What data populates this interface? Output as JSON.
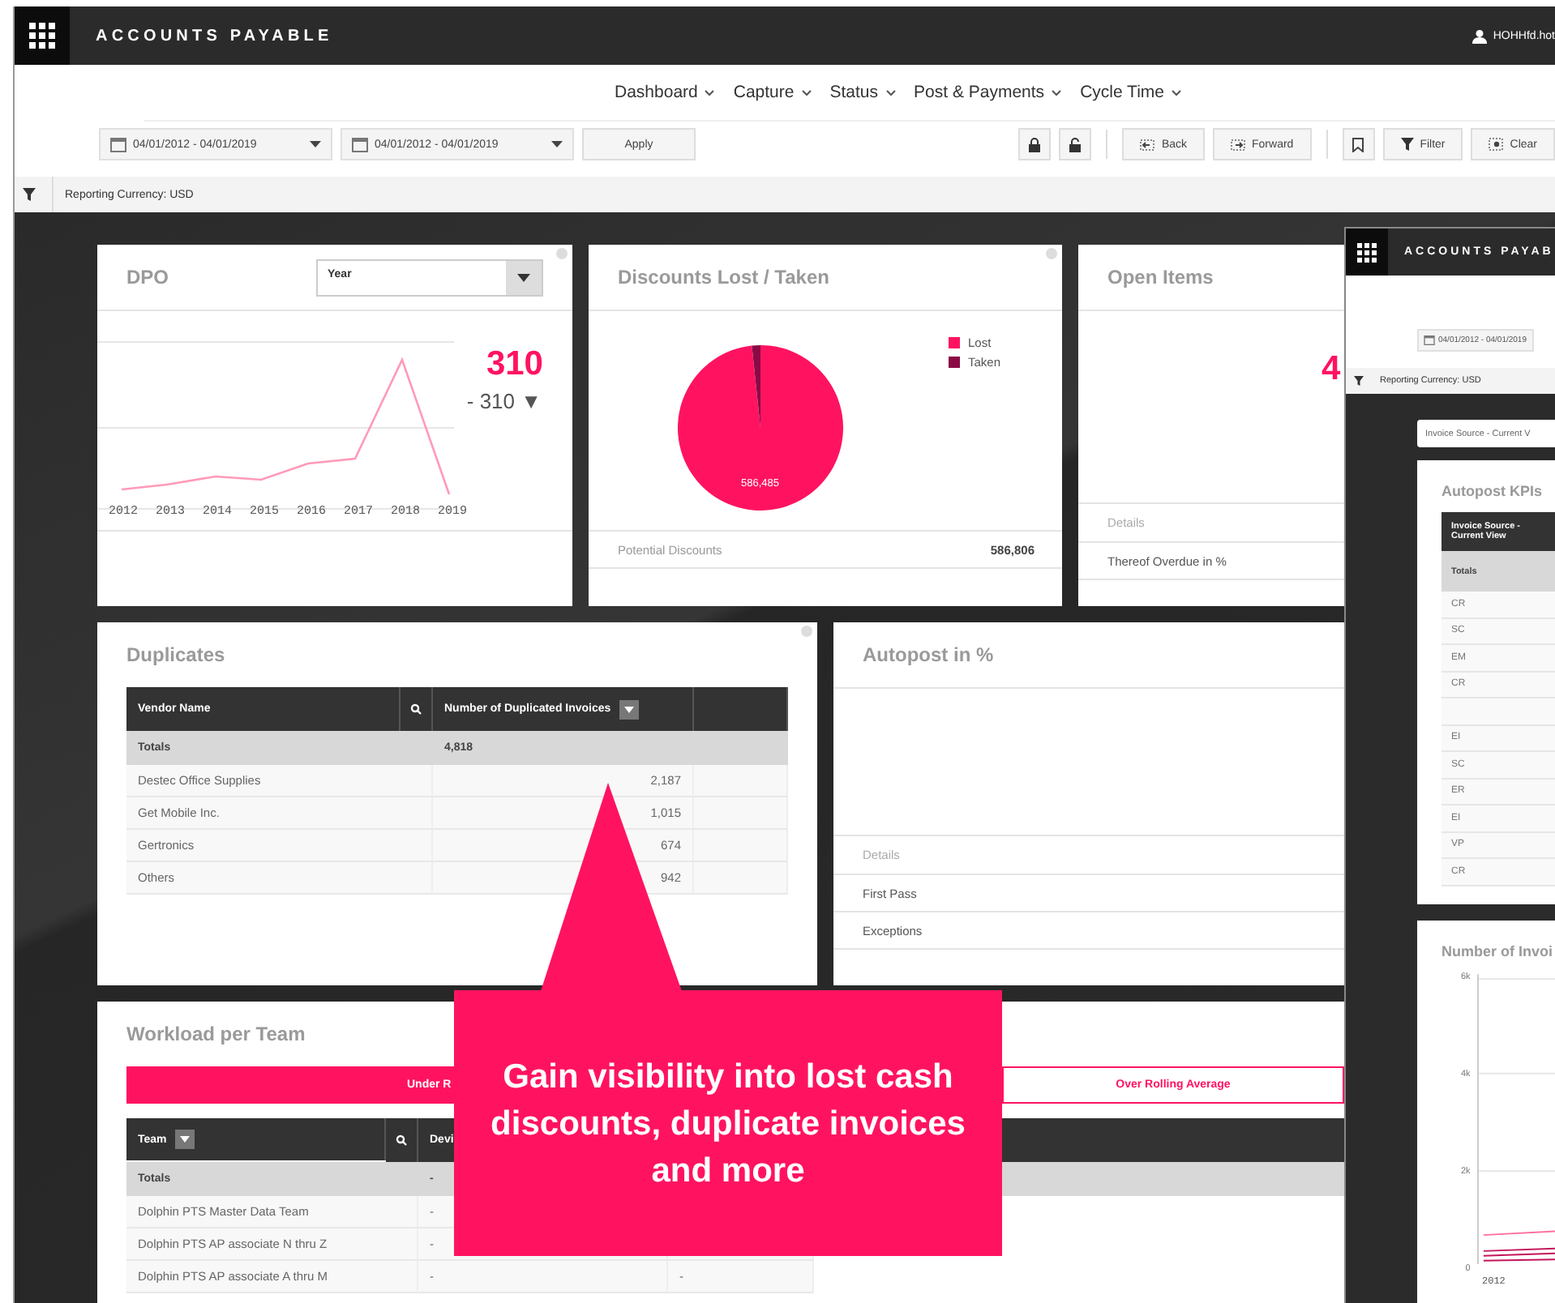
{
  "header": {
    "title": "ACCOUNTS PAYABLE",
    "user": "HOHHfd.hot"
  },
  "nav": [
    {
      "label": "Dashboard"
    },
    {
      "label": "Capture"
    },
    {
      "label": "Status"
    },
    {
      "label": "Post & Payments"
    },
    {
      "label": "Cycle Time"
    }
  ],
  "toolbar": {
    "date_ranges": [
      "04/01/2012 - 04/01/2019",
      "04/01/2012 - 04/01/2019"
    ],
    "apply": "Apply",
    "back": "Back",
    "forward": "Forward",
    "filter": "Filter",
    "clear": "Clear"
  },
  "reporting_currency": "Reporting Currency: USD",
  "dpo": {
    "title": "DPO",
    "period": "Year",
    "value": "310",
    "change": "- 310 ▼",
    "x_labels": [
      "2012",
      "2013",
      "2014",
      "2015",
      "2016",
      "2017",
      "2018",
      "2019"
    ]
  },
  "discounts": {
    "title": "Discounts Lost / Taken",
    "legend": [
      {
        "label": "Lost",
        "color": "#ff1361"
      },
      {
        "label": "Taken",
        "color": "#8a0a45"
      }
    ],
    "slice_label": "586,485",
    "potential_label": "Potential Discounts",
    "potential_value": "586,806"
  },
  "open_items": {
    "title": "Open Items",
    "value": "4",
    "details": "Details",
    "row": "Thereof Overdue in %"
  },
  "duplicates": {
    "title": "Duplicates",
    "columns": [
      "Vendor Name",
      "Number of Duplicated Invoices"
    ],
    "totals": {
      "label": "Totals",
      "value": "4,818"
    },
    "rows": [
      {
        "vendor": "Destec Office Supplies",
        "count": "2,187"
      },
      {
        "vendor": "Get Mobile Inc.",
        "count": "1,015"
      },
      {
        "vendor": "Gertronics",
        "count": "674"
      },
      {
        "vendor": "Others",
        "count": "942"
      }
    ]
  },
  "autopost": {
    "title": "Autopost in %",
    "details": "Details",
    "rows": [
      "First Pass",
      "Exceptions"
    ]
  },
  "workload": {
    "title": "Workload per Team",
    "tabs": [
      {
        "label": "Under R",
        "selected": true
      },
      {
        "label": "Over Rolling Average",
        "selected": false
      }
    ],
    "columns": [
      "Team",
      "Devi"
    ],
    "totals": {
      "label": "Totals",
      "value": "-"
    },
    "rows": [
      {
        "team": "Dolphin PTS Master Data Team",
        "column_2": "-"
      },
      {
        "team": "Dolphin PTS AP associate N thru Z",
        "column_2": "-"
      },
      {
        "team": "Dolphin PTS AP associate A thru M",
        "column_2": "-",
        "column_3": "-"
      }
    ]
  },
  "overlay_window": {
    "title": "ACCOUNTS PAYAB",
    "date_range": "04/01/2012 - 04/01/2019",
    "reporting_currency": "Reporting Currency: USD",
    "view_select": "Invoice Source - Current V",
    "kpi_title": "Autopost KPIs",
    "kpi_column": "Invoice Source - Current View",
    "kpi_totals": "Totals",
    "kpi_rows": [
      "CR",
      "SC",
      "EM",
      "CR",
      "",
      "EI",
      "SC",
      "ER",
      "EI",
      "VP",
      "CR"
    ],
    "chart_title": "Number of Invoi",
    "y_ticks": [
      "6k",
      "4k",
      "2k",
      "0"
    ],
    "x_tick": "2012"
  },
  "callout": {
    "text": "Gain visibility into lost cash discounts, duplicate invoices and more"
  }
}
